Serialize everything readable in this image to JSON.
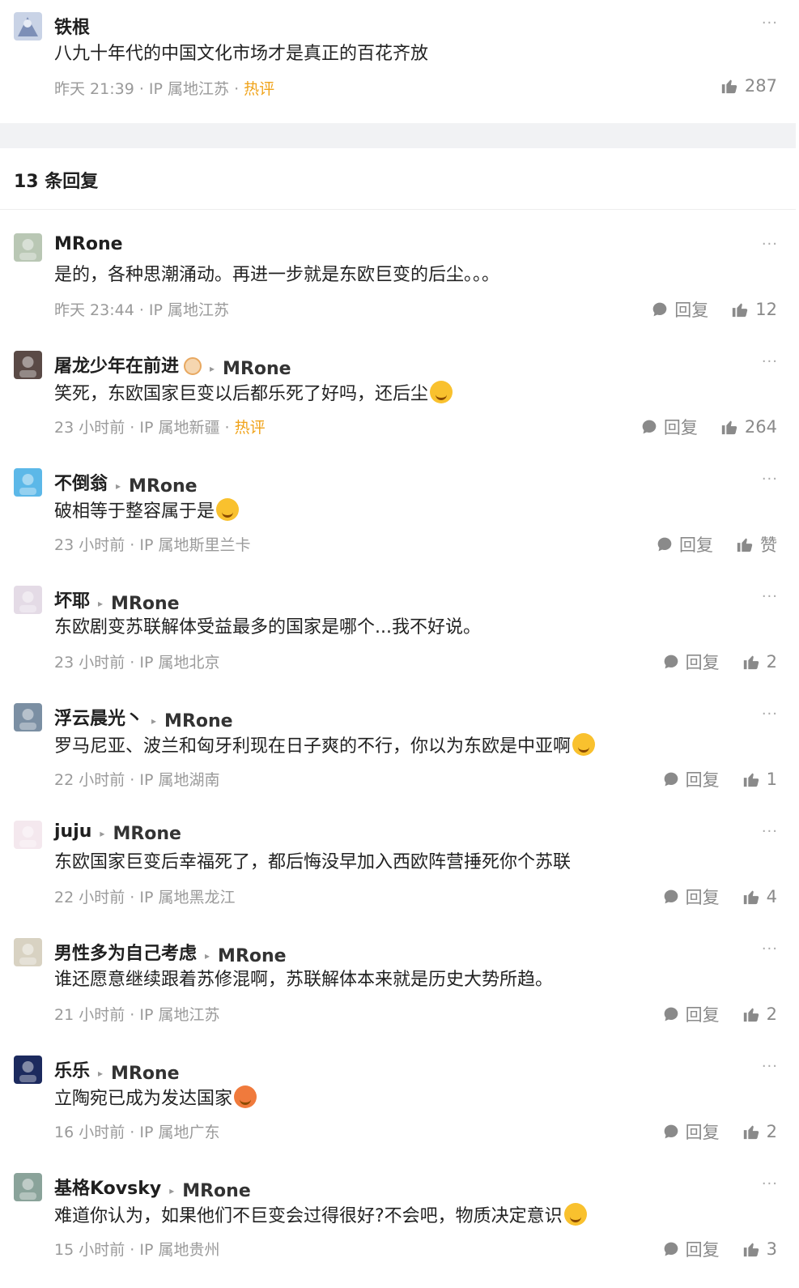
{
  "root": {
    "name": "铁根",
    "content": "八九十年代的中国文化市场才是真正的百花齐放",
    "time": "昨天 21:39",
    "ip": "IP 属地江苏",
    "hot": "热评",
    "likes": "287",
    "more": "···"
  },
  "reply_count": "13 条回复",
  "labels": {
    "reply": "回复",
    "sep": " · "
  },
  "replies": [
    {
      "name": "MRone",
      "target": "",
      "content": "是的，各种思潮涌动。再进一步就是东欧巨变的后尘。。。",
      "time": "昨天 23:44",
      "ip": "IP 属地江苏",
      "hot": "",
      "likes": "12",
      "emoji": ""
    },
    {
      "name": "屠龙少年在前进",
      "target": "MRone",
      "content": "笑死，东欧国家巨变以后都乐死了好吗，还后尘",
      "time": "23 小时前",
      "ip": "IP 属地新疆",
      "hot": "热评",
      "likes": "264",
      "emoji": "laugh"
    },
    {
      "name": "不倒翁",
      "target": "MRone",
      "content": "破相等于整容属于是",
      "time": "23 小时前",
      "ip": "IP 属地斯里兰卡",
      "hot": "",
      "likes": "赞",
      "emoji": "grin"
    },
    {
      "name": "坏耶",
      "target": "MRone",
      "content": "东欧剧变苏联解体受益最多的国家是哪个...我不好说。",
      "time": "23 小时前",
      "ip": "IP 属地北京",
      "hot": "",
      "likes": "2",
      "emoji": ""
    },
    {
      "name": "浮云晨光丶",
      "target": "MRone",
      "content": "罗马尼亚、波兰和匈牙利现在日子爽的不行，你以为东欧是中亚啊",
      "time": "22 小时前",
      "ip": "IP 属地湖南",
      "hot": "",
      "likes": "1",
      "emoji": "laugh"
    },
    {
      "name": "juju",
      "target": "MRone",
      "content": "东欧国家巨变后幸福死了，都后悔没早加入西欧阵营捶死你个苏联",
      "time": "22 小时前",
      "ip": "IP 属地黑龙江",
      "hot": "",
      "likes": "4",
      "emoji": ""
    },
    {
      "name": "男性多为自己考虑",
      "target": "MRone",
      "content": "谁还愿意继续跟着苏修混啊，苏联解体本来就是历史大势所趋。",
      "time": "21 小时前",
      "ip": "IP 属地江苏",
      "hot": "",
      "likes": "2",
      "emoji": ""
    },
    {
      "name": "乐乐",
      "target": "MRone",
      "content": "立陶宛已成为发达国家",
      "time": "16 小时前",
      "ip": "IP 属地广东",
      "hot": "",
      "likes": "2",
      "emoji": "angry"
    },
    {
      "name": "基格Kovsky",
      "target": "MRone",
      "content": "难道你认为，如果他们不巨变会过得很好?不会吧，物质决定意识",
      "time": "15 小时前",
      "ip": "IP 属地贵州",
      "hot": "",
      "likes": "3",
      "emoji": "think"
    }
  ],
  "colors": {
    "hot": "#f0a31a",
    "meta": "#9a9a9a",
    "band": "#f1f2f4"
  }
}
